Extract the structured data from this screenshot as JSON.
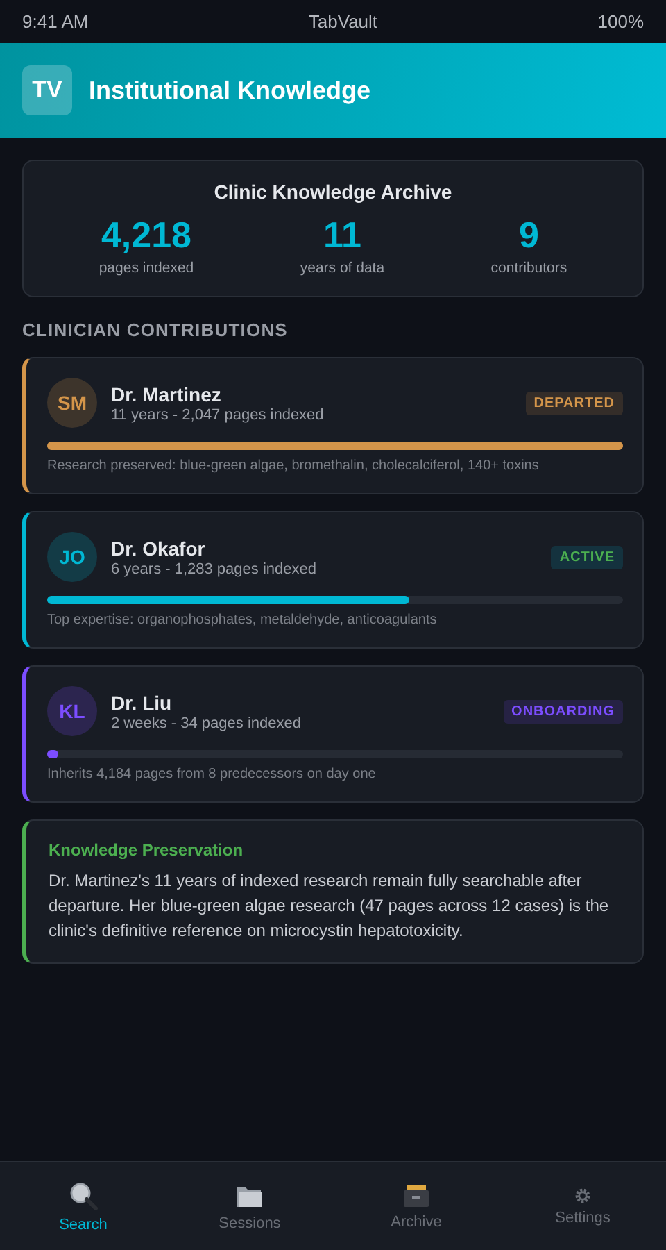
{
  "status_bar": {
    "time": "9:41 AM",
    "title": "TabVault",
    "battery": "100%"
  },
  "header": {
    "logo": "TV",
    "title": "Institutional Knowledge"
  },
  "summary": {
    "title": "Clinic Knowledge Archive",
    "stats": [
      {
        "value": "4,218",
        "label": "pages indexed"
      },
      {
        "value": "11",
        "label": "years of data"
      },
      {
        "value": "9",
        "label": "contributors"
      }
    ]
  },
  "section_title": "CLINICIAN CONTRIBUTIONS",
  "clinicians": [
    {
      "initials": "SM",
      "name": "Dr. Martinez",
      "meta": "11 years - 2,047 pages indexed",
      "status": "DEPARTED",
      "color": "#d4954a",
      "level": 1,
      "note": "Research preserved: blue-green algae, bromethalin, cholecalciferol, 140+ toxins"
    },
    {
      "initials": "JO",
      "name": "Dr. Okafor",
      "meta": "6 years - 1,283 pages indexed",
      "status": "ACTIVE",
      "color": "#00b8d4",
      "level": 0.63,
      "note": "Top expertise: organophosphates, metaldehyde, anticoagulants"
    },
    {
      "initials": "KL",
      "name": "Dr. Liu",
      "meta": "2 weeks - 34 pages indexed",
      "status": "ONBOARDING",
      "color": "#7c4dff",
      "level": 0.02,
      "note": "Inherits 4,184 pages from 8 predecessors on day one"
    }
  ],
  "callout": {
    "title": "Knowledge Preservation",
    "text": "Dr. Martinez's 11 years of indexed research remain fully searchable after departure. Her blue-green algae research (47 pages across 12 cases) is the clinic's definitive reference on microcystin hepatotoxicity."
  },
  "tabs": [
    {
      "kind": "search",
      "label": "Search",
      "selected": true
    },
    {
      "kind": "folder",
      "label": "Sessions",
      "selected": false
    },
    {
      "kind": "archive",
      "label": "Archive",
      "selected": false
    },
    {
      "kind": "gear",
      "label": "Settings",
      "selected": false
    }
  ]
}
